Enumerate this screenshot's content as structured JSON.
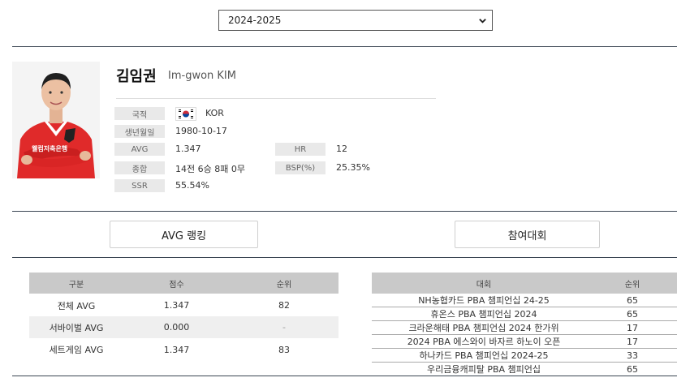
{
  "season_select": {
    "value": "2024-2025",
    "icon": "chevron-down-icon"
  },
  "player": {
    "name_ko": "김임권",
    "name_en": "Im-gwon KIM",
    "photo_jersey_text": "웰컴저축은행",
    "fields": {
      "nationality_label": "국적",
      "nationality_value": "KOR",
      "birth_label": "생년월일",
      "birth_value": "1980-10-17",
      "avg_label": "AVG",
      "avg_value": "1.347",
      "hr_label": "HR",
      "hr_value": "12",
      "overall_label": "종합",
      "overall_value": "14전 6승 8패 0무",
      "bsp_label": "BSP(%)",
      "bsp_value": "25.35%",
      "ssr_label": "SSR",
      "ssr_value": "55.54%"
    }
  },
  "tabs": {
    "avg_ranking": "AVG 랭킹",
    "tournaments": "참여대회"
  },
  "avg_table": {
    "headers": [
      "구분",
      "점수",
      "순위"
    ],
    "rows": [
      [
        "전체 AVG",
        "1.347",
        "82"
      ],
      [
        "서바이벌 AVG",
        "0.000",
        "-"
      ],
      [
        "세트게임 AVG",
        "1.347",
        "83"
      ]
    ]
  },
  "tournament_table": {
    "headers": [
      "대회",
      "순위"
    ],
    "rows": [
      [
        "NH농협카드 PBA 챔피언십 24-25",
        "65"
      ],
      [
        "휴온스 PBA 챔피언십 2024",
        "65"
      ],
      [
        "크라운해태 PBA 챔피언십 2024 한가위",
        "17"
      ],
      [
        "2024 PBA 에스와이 바자르 하노이 오픈",
        "17"
      ],
      [
        "하나카드 PBA 챔피언십 2024-25",
        "33"
      ],
      [
        "우리금융캐피탈 PBA 챔피언십",
        "65"
      ]
    ]
  },
  "colors": {
    "divider": "#3a4552",
    "jersey": "#e02a2a",
    "header_bg": "#c9c9c9",
    "label_bg": "#e9e9e9"
  }
}
